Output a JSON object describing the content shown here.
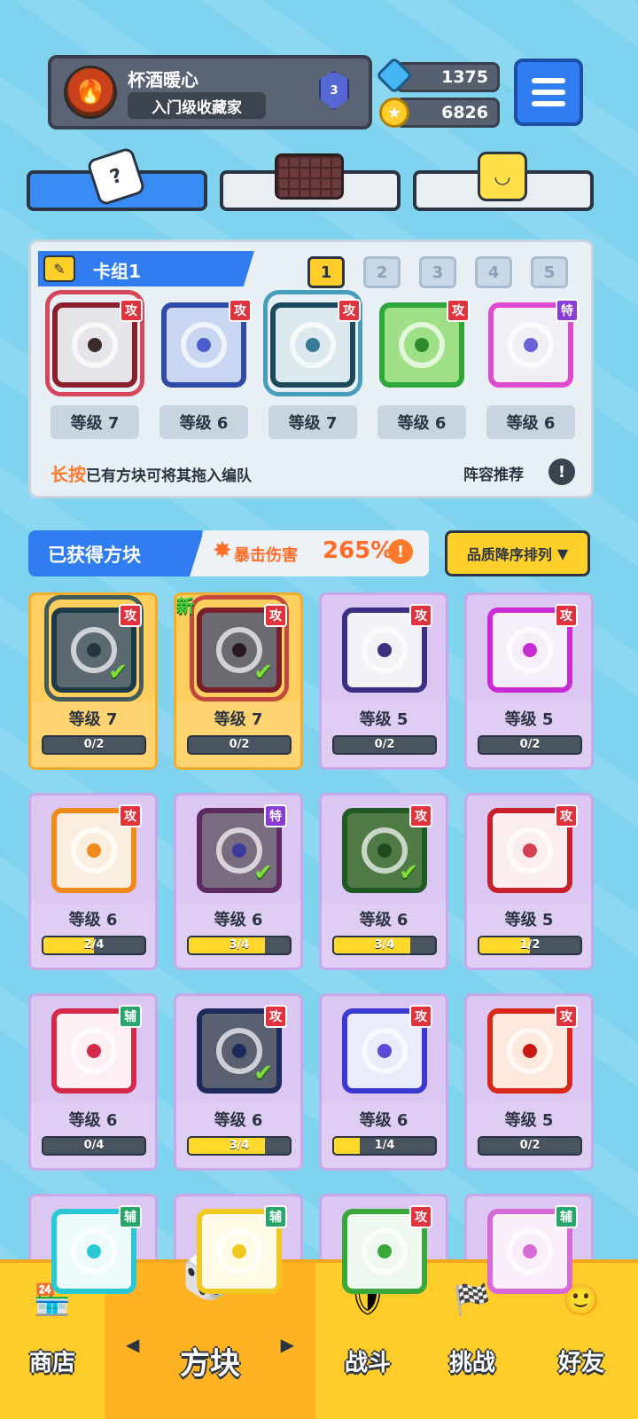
{
  "profile": {
    "name": "杯酒暖心",
    "rank": "入门级收藏家",
    "badge_level": "3"
  },
  "currency": {
    "gems": "1375",
    "coins": "6826"
  },
  "deck": {
    "title": "卡组1",
    "tabs": [
      "1",
      "2",
      "3",
      "4",
      "5"
    ],
    "active_tab": "1",
    "cards": [
      {
        "level": "等级 7",
        "tag": "攻",
        "tag_type": "atk",
        "frame": "#8b1f2e",
        "bg": "#e6e6ea",
        "dot": "#3d2a2a",
        "dragon": "#d1293e"
      },
      {
        "level": "等级 6",
        "tag": "攻",
        "tag_type": "atk",
        "frame": "#2f4aa8",
        "bg": "#c9d6f2",
        "dot": "#4a5ed0",
        "dragon": ""
      },
      {
        "level": "等级 7",
        "tag": "攻",
        "tag_type": "atk",
        "frame": "#1c4a5c",
        "bg": "#dbe9ef",
        "dot": "#3a7a96",
        "dragon": "#2a8fb0"
      },
      {
        "level": "等级 6",
        "tag": "攻",
        "tag_type": "atk",
        "frame": "#2fa53a",
        "bg": "#9fe086",
        "dot": "#2f8a2e",
        "dragon": ""
      },
      {
        "level": "等级 6",
        "tag": "特",
        "tag_type": "spc",
        "frame": "#e04ad0",
        "bg": "#f2f0f6",
        "dot": "#6a60d8",
        "dragon": ""
      }
    ],
    "hint_bold": "长按",
    "hint_text": "已有方块可将其拖入编队",
    "recommend": "阵容推荐"
  },
  "obtained": {
    "title": "已获得方块",
    "crit_label": "暴击伤害",
    "crit_value": "265%",
    "sort_label": "品质降序排列",
    "sort_arrow": "▼",
    "new_label": "新",
    "cards": [
      {
        "level": "等级 7",
        "progress": "0/2",
        "fill": 0,
        "tag": "攻",
        "tag_type": "atk",
        "gold": true,
        "frame": "#1c3a48",
        "bg": "#5a6a70",
        "dot": "#243640",
        "checked": true,
        "new": false,
        "dragon": "#21485a"
      },
      {
        "level": "等级 7",
        "progress": "0/2",
        "fill": 0,
        "tag": "攻",
        "tag_type": "atk",
        "gold": true,
        "frame": "#7a1f2a",
        "bg": "#6a6a70",
        "dot": "#2a1a20",
        "checked": true,
        "new": true,
        "dragon": "#b8303a"
      },
      {
        "level": "等级 5",
        "progress": "0/2",
        "fill": 0,
        "tag": "攻",
        "tag_type": "atk",
        "gold": false,
        "frame": "#3a2f80",
        "bg": "#f4f2f6",
        "dot": "#3a2f80",
        "checked": false,
        "new": false,
        "dragon": ""
      },
      {
        "level": "等级 5",
        "progress": "0/2",
        "fill": 0,
        "tag": "攻",
        "tag_type": "atk",
        "gold": false,
        "frame": "#c82ad6",
        "bg": "#f6eef8",
        "dot": "#c82ad6",
        "checked": false,
        "new": false,
        "dragon": ""
      },
      {
        "level": "等级 6",
        "progress": "2/4",
        "fill": 0.5,
        "tag": "攻",
        "tag_type": "atk",
        "gold": false,
        "frame": "#f08a1a",
        "bg": "#fbeede",
        "dot": "#f08a1a",
        "checked": false,
        "new": false,
        "dragon": ""
      },
      {
        "level": "等级 6",
        "progress": "3/4",
        "fill": 0.75,
        "tag": "特",
        "tag_type": "spc",
        "gold": false,
        "frame": "#5a2a60",
        "bg": "#7a6c80",
        "dot": "#3a3aa0",
        "checked": true,
        "new": false,
        "dragon": ""
      },
      {
        "level": "等级 6",
        "progress": "3/4",
        "fill": 0.75,
        "tag": "攻",
        "tag_type": "atk",
        "gold": false,
        "frame": "#1f5a24",
        "bg": "#4f7a46",
        "dot": "#1f4a1f",
        "checked": true,
        "new": false,
        "dragon": ""
      },
      {
        "level": "等级 5",
        "progress": "1/2",
        "fill": 0.5,
        "tag": "攻",
        "tag_type": "atk",
        "gold": false,
        "frame": "#c8202a",
        "bg": "#fbeeee",
        "dot": "#d44050",
        "checked": false,
        "new": false,
        "dragon": ""
      },
      {
        "level": "等级 6",
        "progress": "0/4",
        "fill": 0,
        "tag": "辅",
        "tag_type": "sup",
        "gold": false,
        "frame": "#d42a4a",
        "bg": "#fdf0f2",
        "dot": "#d42a4a",
        "checked": false,
        "new": false,
        "dragon": ""
      },
      {
        "level": "等级 6",
        "progress": "3/4",
        "fill": 0.75,
        "tag": "攻",
        "tag_type": "atk",
        "gold": false,
        "frame": "#1c2a5c",
        "bg": "#5a6070",
        "dot": "#1c2a5c",
        "checked": true,
        "new": false,
        "dragon": ""
      },
      {
        "level": "等级 6",
        "progress": "1/4",
        "fill": 0.25,
        "tag": "攻",
        "tag_type": "atk",
        "gold": false,
        "frame": "#3a3ad0",
        "bg": "#e8ecfb",
        "dot": "#5a4ad8",
        "checked": false,
        "new": false,
        "dragon": ""
      },
      {
        "level": "等级 5",
        "progress": "0/2",
        "fill": 0,
        "tag": "攻",
        "tag_type": "atk",
        "gold": false,
        "frame": "#d8281a",
        "bg": "#fde8de",
        "dot": "#c81a10",
        "checked": false,
        "new": false,
        "dragon": ""
      },
      {
        "level": "",
        "progress": "",
        "fill": 0,
        "tag": "辅",
        "tag_type": "sup",
        "gold": false,
        "frame": "#28c8d4",
        "bg": "#eefbfc",
        "dot": "#28c8d4",
        "checked": false,
        "new": false,
        "dragon": ""
      },
      {
        "level": "",
        "progress": "",
        "fill": 0,
        "tag": "辅",
        "tag_type": "sup",
        "gold": false,
        "frame": "#f0c820",
        "bg": "#fffbe6",
        "dot": "#f0c820",
        "checked": false,
        "new": false,
        "dragon": ""
      },
      {
        "level": "",
        "progress": "",
        "fill": 0,
        "tag": "攻",
        "tag_type": "atk",
        "gold": false,
        "frame": "#3aa83a",
        "bg": "#eef8ee",
        "dot": "#3aa83a",
        "checked": false,
        "new": false,
        "dragon": ""
      },
      {
        "level": "",
        "progress": "",
        "fill": 0,
        "tag": "辅",
        "tag_type": "sup",
        "gold": false,
        "frame": "#d86ad8",
        "bg": "#fbeefb",
        "dot": "#d86ad8",
        "checked": false,
        "new": false,
        "dragon": ""
      }
    ]
  },
  "nav": {
    "items": [
      {
        "label": "商店",
        "icon": "shop-icon",
        "active": false
      },
      {
        "label": "方块",
        "icon": "cube-icon",
        "active": true
      },
      {
        "label": "战斗",
        "icon": "battle-icon",
        "active": false
      },
      {
        "label": "挑战",
        "icon": "challenge-icon",
        "active": false
      },
      {
        "label": "好友",
        "icon": "friends-icon",
        "active": false
      }
    ],
    "arrow_left": "◀",
    "arrow_right": "▶"
  },
  "colors": {
    "accent": "#2f7df0",
    "gold": "#ffcc2a",
    "crit": "#ff6d2a"
  }
}
